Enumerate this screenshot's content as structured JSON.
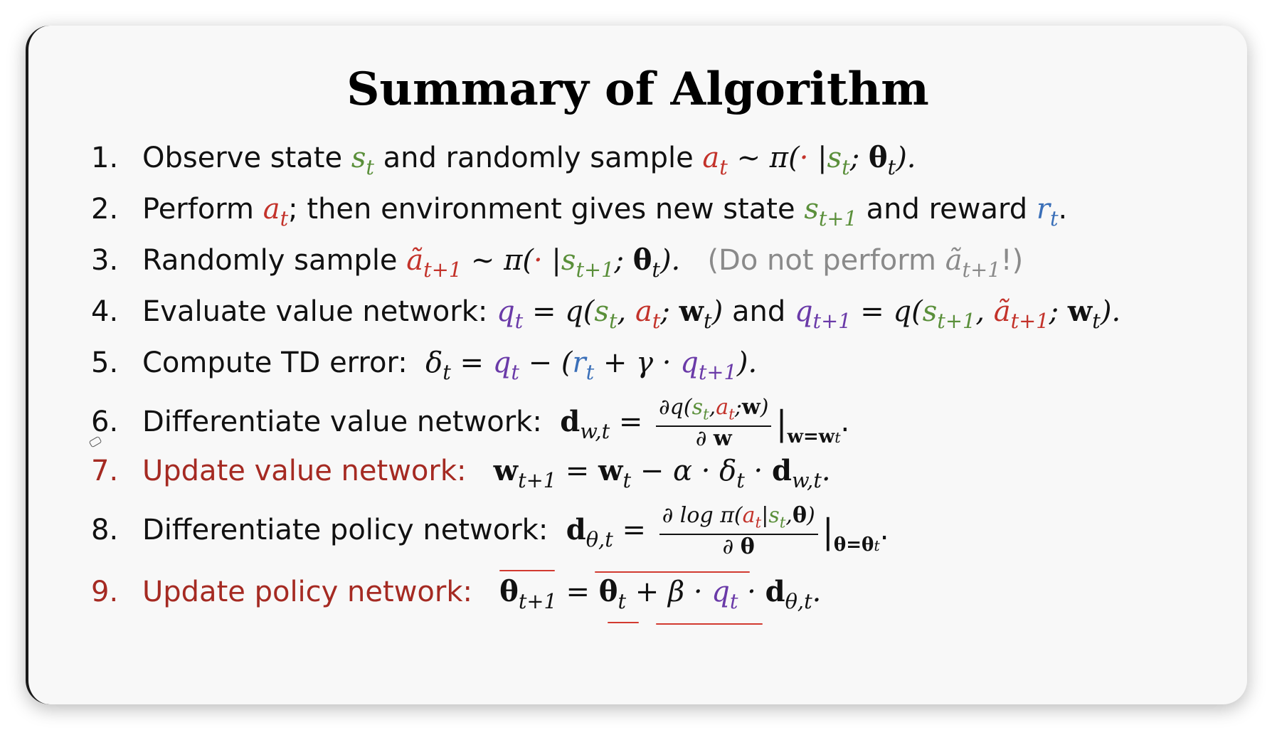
{
  "slide": {
    "title": "Summary of Algorithm",
    "steps": [
      {
        "num": "1.",
        "label": "Observe state",
        "and_randomly": "and randomly sample"
      },
      {
        "num": "2.",
        "label": "Perform",
        "then_env": "; then environment gives new state",
        "and_reward": "and reward"
      },
      {
        "num": "3.",
        "label": "Randomly sample",
        "note_open": "(Do not perform",
        "note_close": "!)"
      },
      {
        "num": "4.",
        "label": "Evaluate value network:",
        "and": "and"
      },
      {
        "num": "5.",
        "label": "Compute TD error:"
      },
      {
        "num": "6.",
        "label": "Differentiate value network:"
      },
      {
        "num": "7.",
        "label": "Update value network:"
      },
      {
        "num": "8.",
        "label": "Differentiate policy network:"
      },
      {
        "num": "9.",
        "label": "Update policy network:"
      }
    ]
  },
  "colors": {
    "state": "#5a8f3a",
    "action": "#c3322a",
    "q_value": "#6a3aa8",
    "reward": "#3a6fb8",
    "update_steps": "#a52a22",
    "annotation_underline": "#d23a30"
  }
}
